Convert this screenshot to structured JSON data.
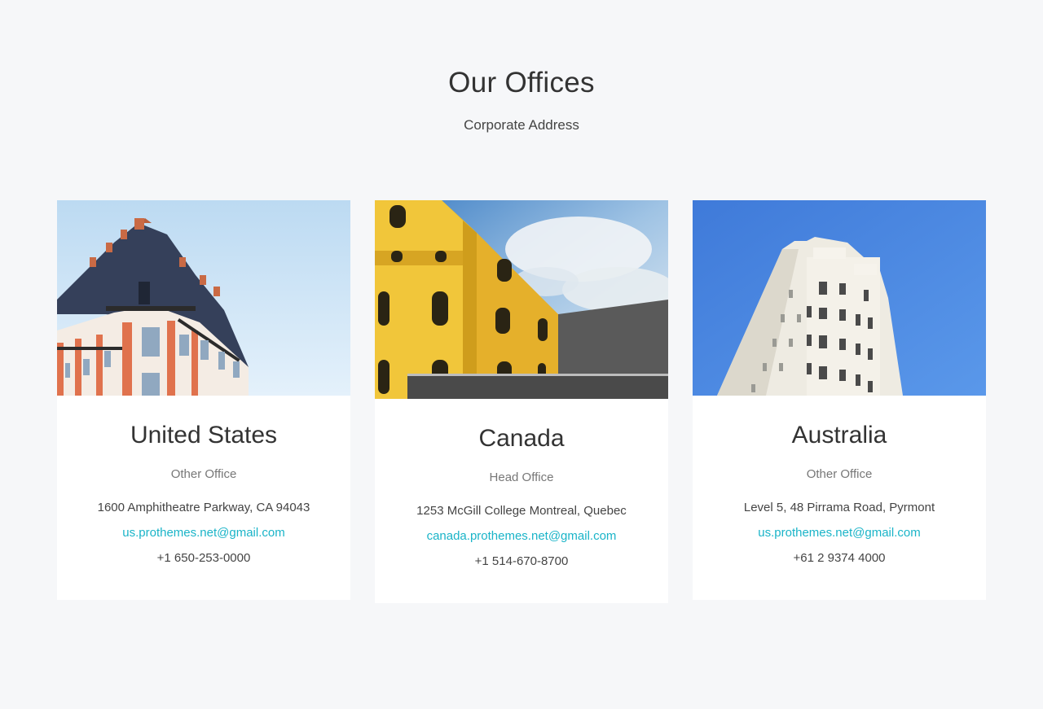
{
  "section": {
    "title": "Our Offices",
    "subtitle": "Corporate Address"
  },
  "offices": [
    {
      "country": "United States",
      "type": "Other Office",
      "address": "1600 Amphitheatre Parkway, CA 94043",
      "email": "us.prothemes.net@gmail.com",
      "phone": "+1 650-253-0000",
      "photo_icon": "building-photo"
    },
    {
      "country": "Canada",
      "type": "Head Office",
      "address": "1253 McGill College Montreal, Quebec",
      "email": "canada.prothemes.net@gmail.com",
      "phone": "+1 514-670-8700",
      "photo_icon": "building-photo"
    },
    {
      "country": "Australia",
      "type": "Other Office",
      "address": "Level 5, 48 Pirrama Road, Pyrmont",
      "email": "us.prothemes.net@gmail.com",
      "phone": "+61 2 9374 4000",
      "photo_icon": "building-photo"
    }
  ],
  "colors": {
    "background": "#f6f7f9",
    "card": "#ffffff",
    "link": "#1ab4c8",
    "text": "#333333"
  }
}
